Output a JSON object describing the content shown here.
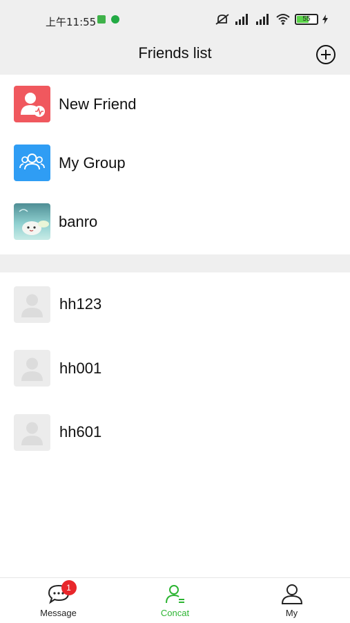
{
  "status_bar": {
    "time": "上午11:55",
    "battery": "55"
  },
  "header": {
    "title": "Friends list"
  },
  "shortcuts": [
    {
      "label": "New Friend",
      "color": "#f0585e",
      "icon": "user-heartbeat-icon"
    },
    {
      "label": "My Group",
      "color": "#2f9df4",
      "icon": "group-icon"
    },
    {
      "label": "banro",
      "color": "#7ec6c9",
      "icon": "avatar-photo"
    }
  ],
  "friends": [
    {
      "name": "hh123"
    },
    {
      "name": "hh001"
    },
    {
      "name": "hh601"
    }
  ],
  "tabbar": {
    "items": [
      {
        "label": "Message",
        "badge": "1"
      },
      {
        "label": "Concat"
      },
      {
        "label": "My"
      }
    ],
    "active_color": "#2bb431"
  }
}
